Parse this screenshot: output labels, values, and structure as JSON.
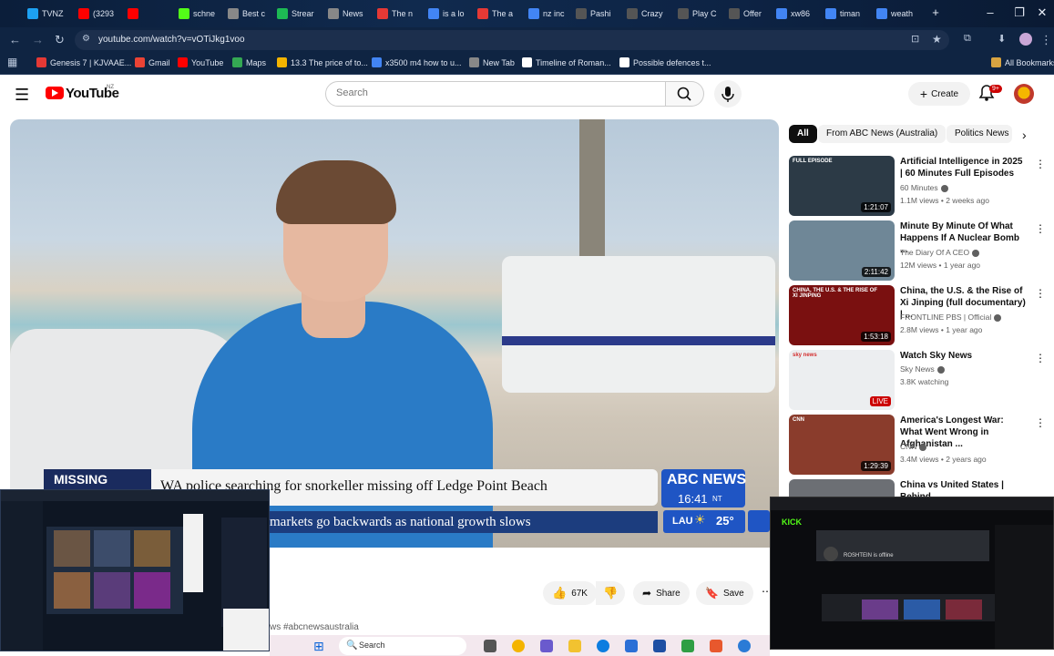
{
  "browser": {
    "tabs": [
      {
        "label": "TVNZ",
        "color": "#1da1f2"
      },
      {
        "label": "(3293",
        "color": "#ff0000"
      },
      {
        "label": "",
        "color": "#ff0000"
      },
      {
        "label": "schne",
        "color": "#53fc18"
      },
      {
        "label": "Best c",
        "color": "#888888"
      },
      {
        "label": "Strear",
        "color": "#1db954"
      },
      {
        "label": "News",
        "color": "#888888"
      },
      {
        "label": "The n",
        "color": "#e53935"
      },
      {
        "label": "is a lo",
        "color": "#4285f4"
      },
      {
        "label": "The a",
        "color": "#e53935"
      },
      {
        "label": "nz inc",
        "color": "#4285f4"
      },
      {
        "label": "Pashi",
        "color": "#555555"
      },
      {
        "label": "Crazy",
        "color": "#555555"
      },
      {
        "label": "Play C",
        "color": "#555555"
      },
      {
        "label": "Offer",
        "color": "#555555"
      },
      {
        "label": "xw86",
        "color": "#4285f4"
      },
      {
        "label": "timan",
        "color": "#4285f4"
      },
      {
        "label": "weath",
        "color": "#4285f4"
      }
    ],
    "url": "youtube.com/watch?v=vOTiJkg1voo",
    "bookmarks": [
      {
        "label": "Genesis 7 | KJVAAE...",
        "color": "#e53935"
      },
      {
        "label": "Gmail",
        "color": "#ea4335"
      },
      {
        "label": "YouTube",
        "color": "#ff0000"
      },
      {
        "label": "Maps",
        "color": "#34a853"
      },
      {
        "label": "13.3 The price of to...",
        "color": "#f4b400"
      },
      {
        "label": "x3500 m4 how to u...",
        "color": "#4285f4"
      },
      {
        "label": "New Tab",
        "color": "#888888"
      },
      {
        "label": "Timeline of Roman...",
        "color": "#ffffff"
      },
      {
        "label": "Possible defences t...",
        "color": "#ffffff"
      }
    ],
    "all_bookmarks": "All Bookmarks"
  },
  "youtube": {
    "logo_text": "YouTube",
    "region": "NZ",
    "search_placeholder": "Search",
    "create_label": "Create",
    "notifications": "9+"
  },
  "video": {
    "lower_third": {
      "tag": "MISSING",
      "headline": "WA police searching for snorkeller missing off Ledge Point Beach",
      "ticker": "markets go backwards as national growth slows",
      "network": "ABC NEWS",
      "time": "16:41",
      "timezone": "NT",
      "weather_location": "LAU",
      "temperature": "25°"
    },
    "likes": "67K",
    "share_label": "Share",
    "save_label": "Save",
    "hashtag_snippet": "ws #abcnewsaustralia"
  },
  "chips": [
    "All",
    "From ABC News (Australia)",
    "Politics News"
  ],
  "recommendations": [
    {
      "title": "Artificial Intelligence in 2025 | 60 Minutes Full Episodes",
      "channel": "60 Minutes",
      "meta": "1.1M views • 2 weeks ago",
      "duration": "1:21:07",
      "badge": "FULL EPISODE",
      "thumb": "#2c3a46"
    },
    {
      "title": "Minute By Minute Of What Happens If A Nuclear Bomb ...",
      "channel": "The Diary Of A CEO",
      "meta": "12M views • 1 year ago",
      "duration": "2:11:42",
      "badge": "",
      "thumb": "#6f8797"
    },
    {
      "title": "China, the U.S. & the Rise of Xi Jinping (full documentary) | ...",
      "channel": "FRONTLINE PBS | Official",
      "meta": "2.8M views • 1 year ago",
      "duration": "1:53:18",
      "badge": "CHINA, THE U.S. & THE RISE OF XI JINPING",
      "thumb": "#7a1010"
    },
    {
      "title": "Watch Sky News",
      "channel": "Sky News",
      "meta": "3.8K watching",
      "duration": "LIVE",
      "badge": "sky news",
      "thumb": "#eceef0"
    },
    {
      "title": "America's Longest War: What Went Wrong in Afghanistan ...",
      "channel": "CNN",
      "meta": "3.4M views • 2 years ago",
      "duration": "1:29:39",
      "badge": "CNN",
      "thumb": "#8a3c2c"
    },
    {
      "title": "China vs United States | Behind",
      "channel": "",
      "meta": "",
      "duration": "",
      "badge": "",
      "thumb": "#6c6f74"
    }
  ],
  "overlay_right": {
    "brand": "KICK",
    "status": "ROSHTEIN is offline"
  },
  "taskbar": {
    "search_label": "Search"
  }
}
